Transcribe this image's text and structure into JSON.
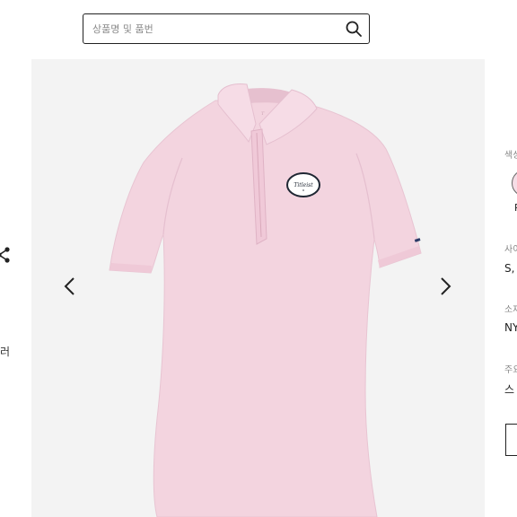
{
  "search": {
    "placeholder": "상품명 및 품번"
  },
  "product": {
    "image_alt": "핑크 폴로 셔츠",
    "logo_text": "Titleist"
  },
  "left_edge": {
    "text": "러"
  },
  "info_panel": {
    "color_label": "색상",
    "color_swatch_label": "P",
    "color_swatch_hex": "#f6dde6",
    "size_label": "사이즈",
    "size_value": "S,",
    "material_label": "소재",
    "material_value": "NY",
    "notice_label": "주요",
    "notice_value": "스"
  },
  "colors": {
    "accent": "#222222",
    "background": "#f3f3f3",
    "shirt": "#f3d4df"
  }
}
